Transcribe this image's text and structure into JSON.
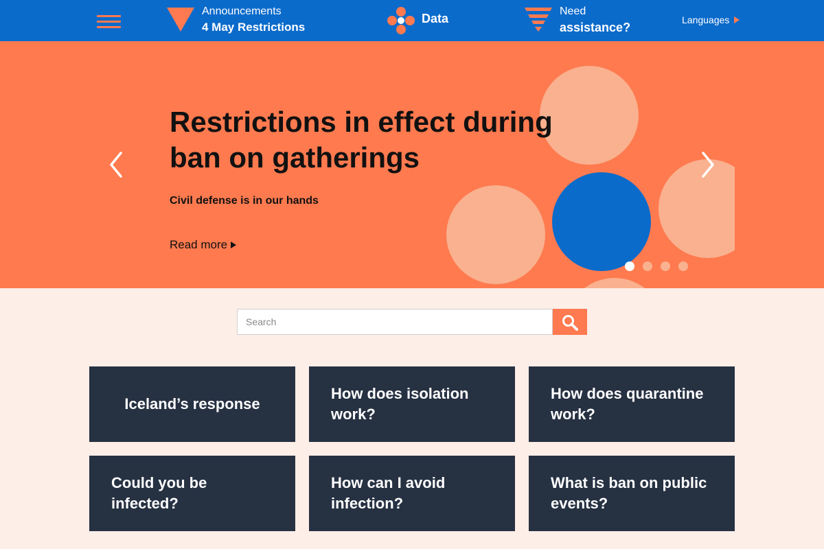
{
  "header": {
    "announcements": {
      "label": "Announcements",
      "value": "4 May Restrictions"
    },
    "data": {
      "label": "Data"
    },
    "help": {
      "label": "Need",
      "value": "assistance?"
    },
    "languages": "Languages"
  },
  "hero": {
    "title": "Restrictions in effect during ban on gatherings",
    "subtitle": "Civil defense is in our hands",
    "read_more": "Read more",
    "slide_count": 4,
    "active_slide": 1
  },
  "search": {
    "placeholder": "Search"
  },
  "cards": [
    {
      "label": "Iceland’s response"
    },
    {
      "label": "How does isolation work?"
    },
    {
      "label": "How does quarantine work?"
    },
    {
      "label": "Could you be infected?"
    },
    {
      "label": "How can I avoid infection?"
    },
    {
      "label": "What is ban on public events?"
    }
  ],
  "colors": {
    "brand_blue": "#0b6bcb",
    "accent_orange": "#ff7a50",
    "hero_orange": "#ff7a4f",
    "pale_peach": "#f9b18f",
    "card_navy": "#263142",
    "page_background": "#fdeee8"
  },
  "icons": {
    "menu": "hamburger-icon",
    "announcements": "triangle-icon",
    "data": "dots-cluster-icon",
    "help": "striped-funnel-icon",
    "search": "magnifier-icon",
    "prev": "chevron-left-icon",
    "next": "chevron-right-icon"
  }
}
